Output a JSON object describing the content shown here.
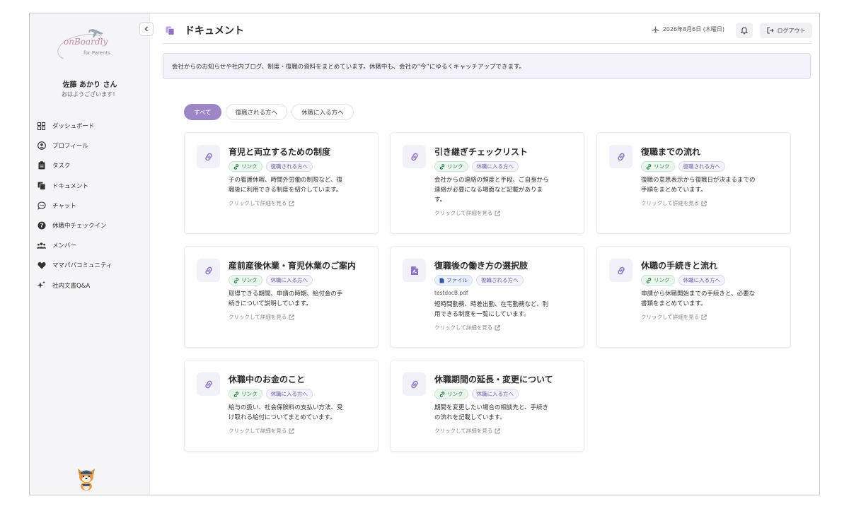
{
  "sidebar": {
    "logo_text": "onBoardly",
    "logo_sub": "for Parents",
    "user_name": "佐藤 あかり さん",
    "greeting": "おはようございます！",
    "items": [
      {
        "label": "ダッシュボード",
        "icon": "grid-icon"
      },
      {
        "label": "プロフィール",
        "icon": "user-circle-icon"
      },
      {
        "label": "タスク",
        "icon": "clipboard-icon"
      },
      {
        "label": "ドキュメント",
        "icon": "copy-icon"
      },
      {
        "label": "チャット",
        "icon": "chat-bubble-icon"
      },
      {
        "label": "休職中チェックイン",
        "icon": "question-circle-icon"
      },
      {
        "label": "メンバー",
        "icon": "users-icon"
      },
      {
        "label": "ママパパコミュニティ",
        "icon": "heart-icon"
      },
      {
        "label": "社内文書Q&A",
        "icon": "sparkles-icon"
      }
    ]
  },
  "header": {
    "title": "ドキュメント",
    "date": "2026年8月6日 (木曜日)",
    "logout_label": "ログアウト"
  },
  "notice": "会社からのお知らせや社内ブログ、制度・復職の資料をまとめています。休職中も、会社の“今”にゆるくキャッチアップできます。",
  "filters": [
    "すべて",
    "復職される方へ",
    "休職に入る方へ"
  ],
  "active_filter": "すべて",
  "cards": [
    {
      "title": "育児と両立するための制度",
      "type_label": "リンク",
      "category": "復職される方へ",
      "filename": "",
      "desc": [
        "子の看護休暇、時間外労働の制限など、復",
        "職後に利用できる制度を紹介しています。"
      ],
      "more": "クリックして詳細を見る"
    },
    {
      "title": "引き継ぎチェックリスト",
      "type_label": "リンク",
      "category": "休職に入る方へ",
      "filename": "",
      "desc": [
        "会社からの連絡の頻度と手段、ご自身から",
        "連絡が必要になる場面など記載がありま",
        "す。"
      ],
      "more": "クリックして詳細を見る"
    },
    {
      "title": "復職までの流れ",
      "type_label": "リンク",
      "category": "復職される方へ",
      "filename": "",
      "desc": [
        "復職の意思表示から復職日が決まるまでの",
        "手順をまとめています。"
      ],
      "more": "クリックして詳細を見る"
    },
    {
      "title": "産前産後休業・育児休業のご案内",
      "type_label": "リンク",
      "category": "休職に入る方へ",
      "filename": "",
      "desc": [
        "取得できる期間、申請の時期、給付金の手",
        "続きについて説明しています。"
      ],
      "more": "クリックして詳細を見る"
    },
    {
      "title": "復職後の働き方の選択肢",
      "type_label": "ファイル",
      "category": "復職される方へ",
      "filename": "testdocB.pdf",
      "desc": [
        "短時間勤務、時差出勤、在宅勤務など、利",
        "用できる制度を一覧にしています。"
      ],
      "more": "クリックして詳細を見る"
    },
    {
      "title": "休職の手続きと流れ",
      "type_label": "リンク",
      "category": "休職に入る方へ",
      "filename": "",
      "desc": [
        "申請から休職開始までの手続きと、必要な",
        "書類をまとめています。"
      ],
      "more": "クリックして詳細を見る"
    },
    {
      "title": "休職中のお金のこと",
      "type_label": "リンク",
      "category": "休職に入る方へ",
      "filename": "",
      "desc": [
        "給与の扱い、社会保険料の支払い方法、受",
        "け取れる給付についてまとめています。"
      ],
      "more": "クリックして詳細を見る"
    },
    {
      "title": "休職期間の延長・変更について",
      "type_label": "リンク",
      "category": "休職に入る方へ",
      "filename": "",
      "desc": [
        "期間を変更したい場合の相談先と、手続き",
        "の流れを記載しています。"
      ],
      "more": "クリックして詳細を見る"
    }
  ],
  "colors": {
    "accent": "#9d86c6",
    "link_tag": "#2f7d4a",
    "file_tag": "#3459a7"
  }
}
